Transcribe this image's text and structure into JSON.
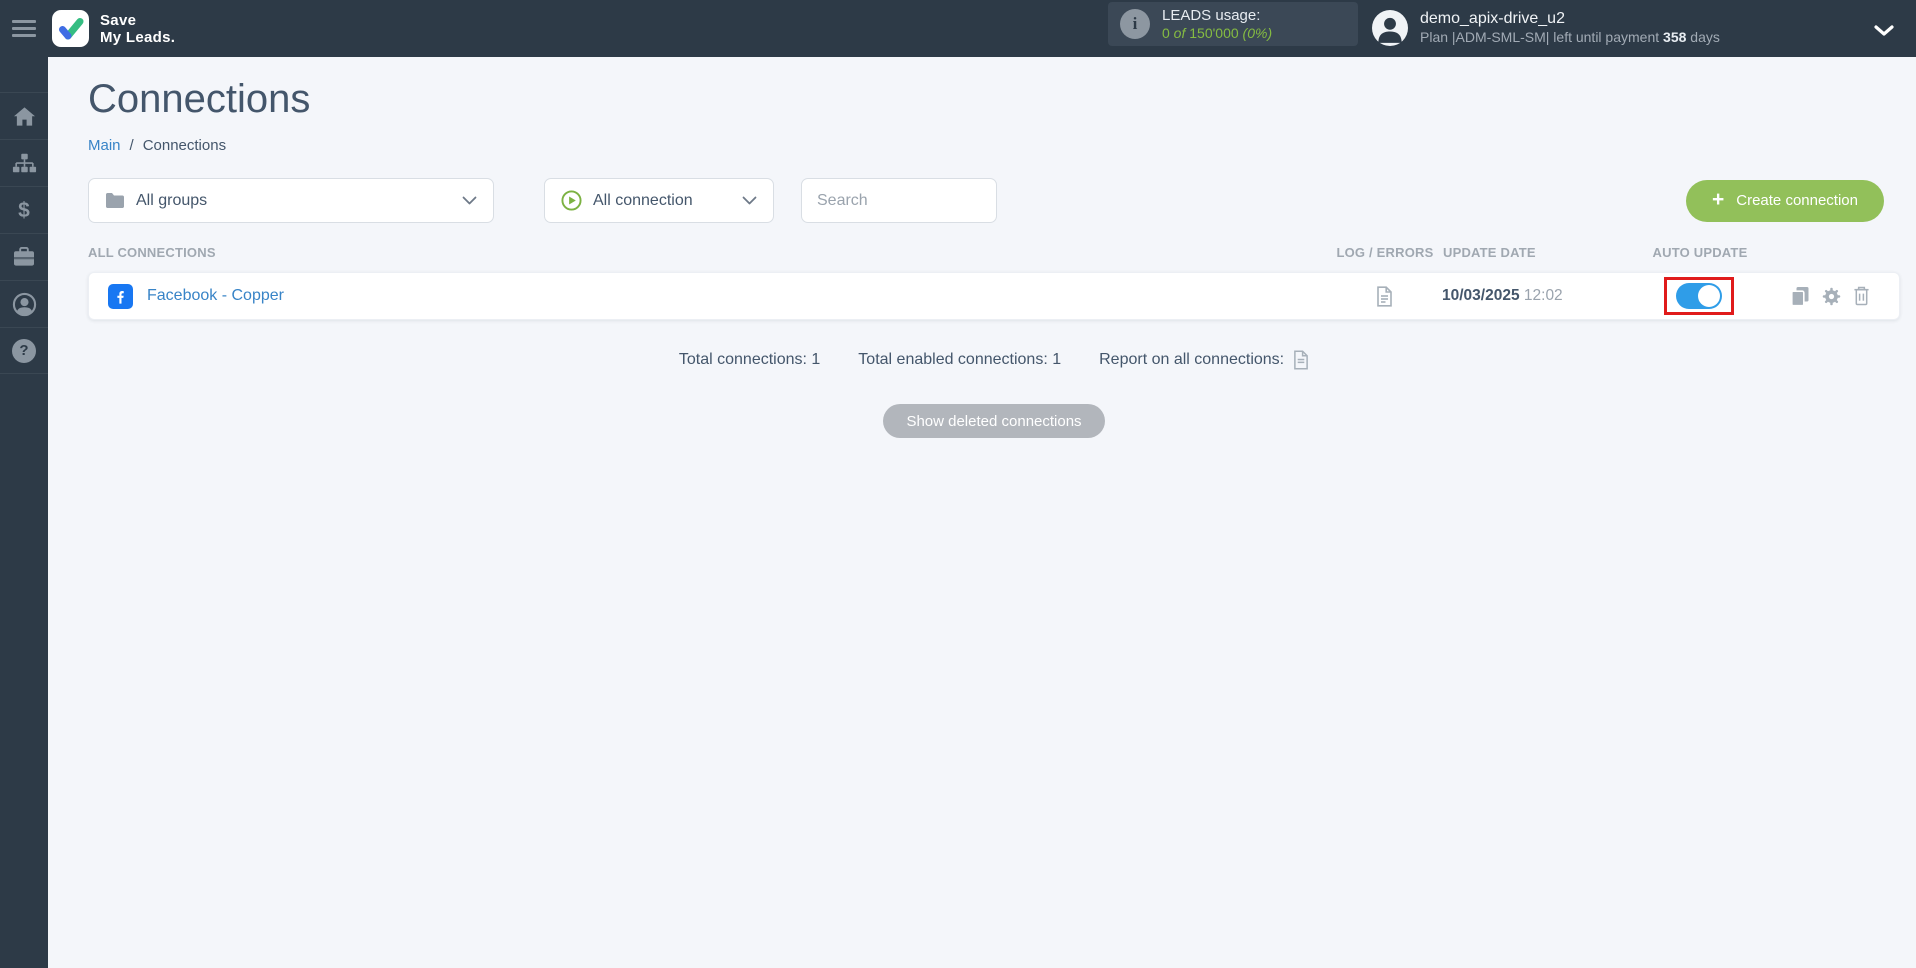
{
  "colors": {
    "header_bg": "#2d3a47",
    "accent_green": "#92c05a",
    "usage_text_green": "#85bb42",
    "toggle_blue": "#2f9de8",
    "facebook_blue": "#1877f2",
    "link_blue": "#3884c7",
    "annotation_red": "#e01b1b"
  },
  "icons": {
    "hamburger": "hamburger-menu-icon",
    "logo_check": "checkmark-icon",
    "info": "i",
    "plus": "+",
    "dollar": "$",
    "help": "?",
    "sidebar": [
      "home-icon",
      "integrations-icon",
      "billing-icon",
      "services-icon",
      "account-icon",
      "help-icon"
    ]
  },
  "header": {
    "logo": {
      "line1": "Save",
      "line2": "My Leads."
    },
    "leads_usage": {
      "label": "LEADS usage:",
      "used": "0",
      "of_word": " of ",
      "total": "150'000",
      "percent": " (0%)"
    },
    "user": {
      "name": "demo_apix-drive_u2",
      "plan_prefix": "Plan |ADM-SML-SM| left until payment ",
      "days": "358",
      "days_suffix": " days"
    }
  },
  "page": {
    "title": "Connections",
    "breadcrumb": {
      "main": "Main",
      "separator": "/",
      "current": "Connections"
    },
    "filters": {
      "groups": "All groups",
      "connection": "All connection",
      "search_placeholder": "Search"
    },
    "create_button": {
      "label": "Create connection"
    },
    "table": {
      "headers": {
        "connections": "ALL CONNECTIONS",
        "log": "LOG / ERRORS",
        "update": "UPDATE DATE",
        "auto": "AUTO UPDATE"
      },
      "rows": [
        {
          "name": "Facebook - Copper",
          "date": "10/03/2025",
          "time": "12:02",
          "auto_update": "on"
        }
      ]
    },
    "totals": {
      "connections": "Total connections: 1",
      "enabled": "Total enabled connections: 1",
      "report": "Report on all connections:"
    },
    "show_deleted": "Show deleted connections"
  }
}
